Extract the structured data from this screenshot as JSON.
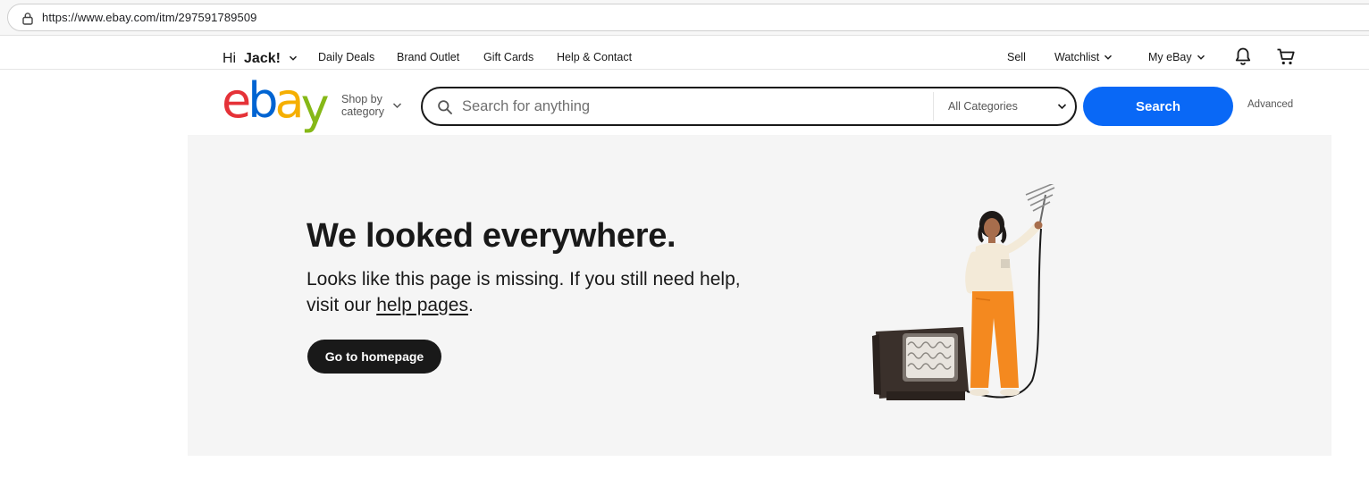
{
  "browser": {
    "url": "https://www.ebay.com/itm/297591789509"
  },
  "topnav": {
    "greeting_prefix": "Hi ",
    "greeting_name": "Jack!",
    "links": [
      "Daily Deals",
      "Brand Outlet",
      "Gift Cards",
      "Help & Contact"
    ],
    "sell": "Sell",
    "watchlist": "Watchlist",
    "my_ebay": "My eBay",
    "icons": [
      "bell-icon",
      "cart-icon"
    ]
  },
  "header": {
    "logo": [
      "e",
      "b",
      "a",
      "y"
    ],
    "logo_colors": [
      "#e53238",
      "#0064d2",
      "#f5af02",
      "#86b817"
    ],
    "shop_by_line1": "Shop by",
    "shop_by_line2": "category",
    "search_placeholder": "Search for anything",
    "category_selected": "All Categories",
    "search_button": "Search",
    "advanced": "Advanced",
    "accent_color": "#0968f6"
  },
  "hero": {
    "title": "We looked everywhere.",
    "text_before_link": "Looks like this page is missing. If you still need help, visit our ",
    "link_text": "help pages",
    "text_after_link": ".",
    "button": "Go to homepage"
  }
}
